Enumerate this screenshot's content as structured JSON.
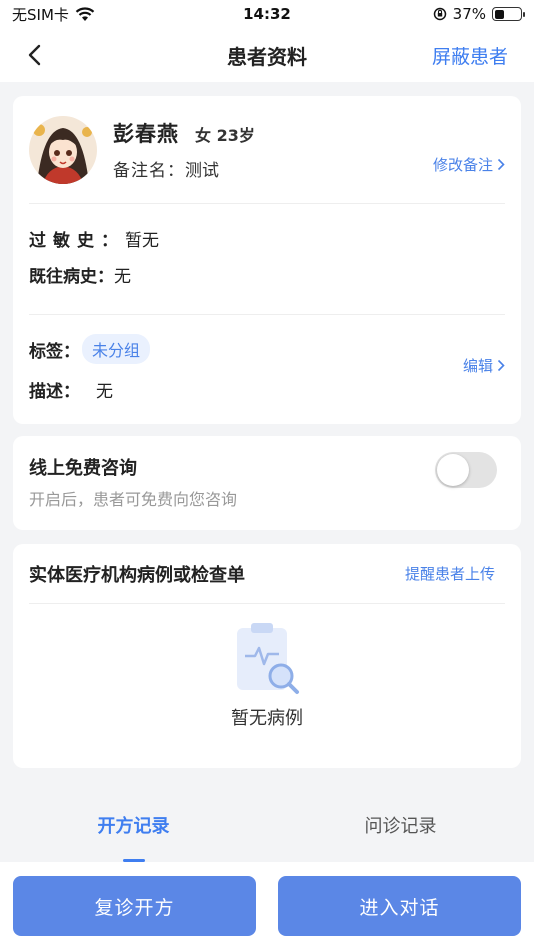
{
  "status_bar": {
    "carrier": "无SIM卡",
    "time": "14:32",
    "battery": "37%",
    "battery_level": 0.37
  },
  "nav": {
    "title": "患者资料",
    "action": "屏蔽患者"
  },
  "profile": {
    "name": "彭春燕",
    "gender_age": "女 23岁",
    "remark_label": "备注名：",
    "remark_value": "测试",
    "edit_remark": "修改备注",
    "allergy_label": "过敏史：",
    "allergy_value": "暂无",
    "past_history_label": "既往病史：",
    "past_history_value": "无",
    "tag_label": "标签：",
    "tag_value": "未分组",
    "desc_label": "描述：",
    "desc_value": "无",
    "edit_tags": "编辑"
  },
  "consult": {
    "title": "线上免费咨询",
    "subtitle": "开启后，患者可免费向您咨询",
    "enabled": false
  },
  "records": {
    "title": "实体医疗机构病例或检查单",
    "action": "提醒患者上传",
    "empty_text": "暂无病例"
  },
  "tabs": [
    {
      "label": "开方记录",
      "active": true
    },
    {
      "label": "问诊记录",
      "active": false
    }
  ],
  "buttons": {
    "revisit": "复诊开方",
    "chat": "进入对话"
  },
  "colors": {
    "accent": "#3f7ef0",
    "button": "#5b87e6"
  }
}
